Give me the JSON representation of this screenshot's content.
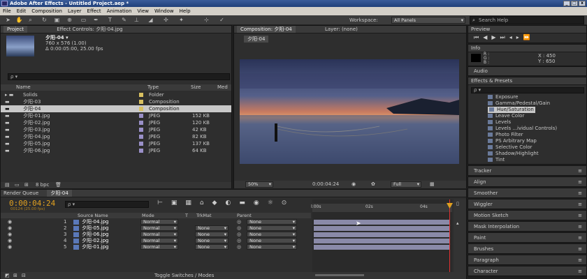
{
  "window": {
    "title": "Adobe After Effects - Untitled Project.aep *",
    "min": "_",
    "max": "□",
    "close": "x"
  },
  "menu": [
    "File",
    "Edit",
    "Composition",
    "Layer",
    "Effect",
    "Animation",
    "View",
    "Window",
    "Help"
  ],
  "toolbar": {
    "workspace_label": "Workspace:",
    "workspace_value": "All Panels",
    "search_placeholder": "Search Help"
  },
  "project": {
    "tab_project": "Project",
    "tab_effects": "Effect Controls: 夕阳-04.jpg",
    "thumb_name": "夕阳-04 ▾",
    "thumb_line1": "760 x 576 (1.00)",
    "thumb_line2": "Δ 0:00:05:00, 25.00 fps",
    "search": "ρ ▾",
    "col_name": "Name",
    "col_type": "Type",
    "col_size": "Size",
    "col_extra": "Med",
    "items": [
      {
        "name": "Solids",
        "type": "Folder",
        "size": "",
        "color": "#d8c060"
      },
      {
        "name": "夕阳-03",
        "type": "Composition",
        "size": "",
        "color": "#d8c060"
      },
      {
        "name": "夕阳-04",
        "type": "Composition",
        "size": "",
        "color": "#d8c060"
      },
      {
        "name": "夕阳-01.jpg",
        "type": "JPEG",
        "size": "152 KB",
        "color": "#9a90c8"
      },
      {
        "name": "夕阳-02.jpg",
        "type": "JPEG",
        "size": "120 KB",
        "color": "#9a90c8"
      },
      {
        "name": "夕阳-03.jpg",
        "type": "JPEG",
        "size": "42 KB",
        "color": "#9a90c8"
      },
      {
        "name": "夕阳-04.jpg",
        "type": "JPEG",
        "size": "82 KB",
        "color": "#9a90c8"
      },
      {
        "name": "夕阳-05.jpg",
        "type": "JPEG",
        "size": "137 KB",
        "color": "#9a90c8"
      },
      {
        "name": "夕阳-06.jpg",
        "type": "JPEG",
        "size": "64 KB",
        "color": "#9a90c8"
      }
    ],
    "bpc": "8 bpc"
  },
  "composition": {
    "tab": "Composition: 夕阳-04",
    "layer_tab": "Layer: (none)",
    "comp_chip": "夕阳-04",
    "zoom": "50%",
    "timecode": "0:00:04:24",
    "resolution": "Full"
  },
  "right": {
    "preview": "Preview",
    "info": "Info",
    "info_r": "R :",
    "info_g": "G :",
    "info_b": "B :",
    "info_x": "X : 450",
    "info_y": "Y : 650",
    "audio": "Audio",
    "effects": "Effects & Presets",
    "fx_search": "ρ ▾",
    "fx_items": [
      "Exposure",
      "Gamma/Pedestal/Gain",
      "Hue/Saturation",
      "Leave Color",
      "Levels",
      "Levels ...ividual Controls)",
      "Photo Filter",
      "PS Arbitrary Map",
      "Selective Color",
      "Shadow/Highlight",
      "Tint"
    ],
    "panels": [
      "Tracker",
      "Align",
      "Smoother",
      "Wiggler",
      "Motion Sketch",
      "Mask Interpolation",
      "Paint",
      "Brushes",
      "Paragraph",
      "Character"
    ]
  },
  "timeline": {
    "tab_render": "Render Queue",
    "tab_comp": "夕阳-04",
    "timecode": "0:00:04:24",
    "frames": "00124 (25.00 fps)",
    "search": "ρ ▾",
    "col_source": "Source Name",
    "col_mode": "Mode",
    "col_t": "T",
    "col_trkmat": "TrkMat",
    "col_parent": "Parent",
    "layers": [
      {
        "num": "1",
        "name": "夕阳-04.jpg",
        "mode": "Normal",
        "trkmat": "",
        "parent": "None"
      },
      {
        "num": "2",
        "name": "夕阳-05.jpg",
        "mode": "Normal",
        "trkmat": "None",
        "parent": "None"
      },
      {
        "num": "3",
        "name": "夕阳-06.jpg",
        "mode": "Normal",
        "trkmat": "None",
        "parent": "None"
      },
      {
        "num": "4",
        "name": "夕阳-02.jpg",
        "mode": "Normal",
        "trkmat": "None",
        "parent": "None"
      },
      {
        "num": "5",
        "name": "夕阳-01.jpg",
        "mode": "Normal",
        "trkmat": "None",
        "parent": "None"
      }
    ],
    "ruler": [
      "l:00s",
      "02s",
      "04s"
    ],
    "toggle": "Toggle Switches / Modes"
  },
  "colors": {
    "timecode": "#e0a020",
    "playhead": "#e03030",
    "layerbar": "#8a8aa8"
  }
}
